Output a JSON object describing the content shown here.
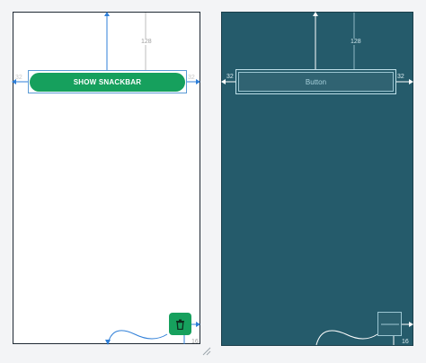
{
  "design": {
    "button_label": "SHOW SNACKBAR",
    "top_margin": "128",
    "left_margin": "32",
    "right_margin": "32",
    "fab_bottom_margin": "16"
  },
  "blueprint": {
    "button_label": "Button",
    "top_margin": "128",
    "left_margin": "32",
    "right_margin": "32",
    "fab_bottom_margin": "16"
  },
  "colors": {
    "accent_green": "#16a05d",
    "blueprint_bg": "#255b6b",
    "constraint_blue": "#2f7fd8"
  },
  "icons": {
    "fab_icon": "trash-icon"
  }
}
